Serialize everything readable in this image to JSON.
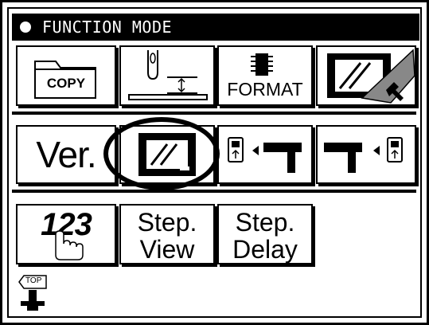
{
  "title_bar": {
    "title": "FUNCTION MODE"
  },
  "row1": {
    "copy_label": "COPY",
    "format_label": "FORMAT"
  },
  "row2": {
    "ver_label": "Ver."
  },
  "row3": {
    "counter_label": "123",
    "step_view_line1": "Step.",
    "step_view_line2": "View",
    "step_delay_line1": "Step.",
    "step_delay_line2": "Delay"
  },
  "footer": {
    "top_label": "TOP"
  },
  "icons": {
    "copy": "folder-copy-icon",
    "thread": "needle-thread-gap-icon",
    "format": "memory-format-icon",
    "screen_settings": "screen-adjust-wrench-icon",
    "display": "lcd-display-icon",
    "send": "usb-to-machine-icon",
    "receive": "machine-to-usb-icon",
    "counter": "hand-counter-icon",
    "top": "top-return-icon"
  },
  "colors": {
    "foreground": "#000000",
    "background": "#ffffff"
  }
}
